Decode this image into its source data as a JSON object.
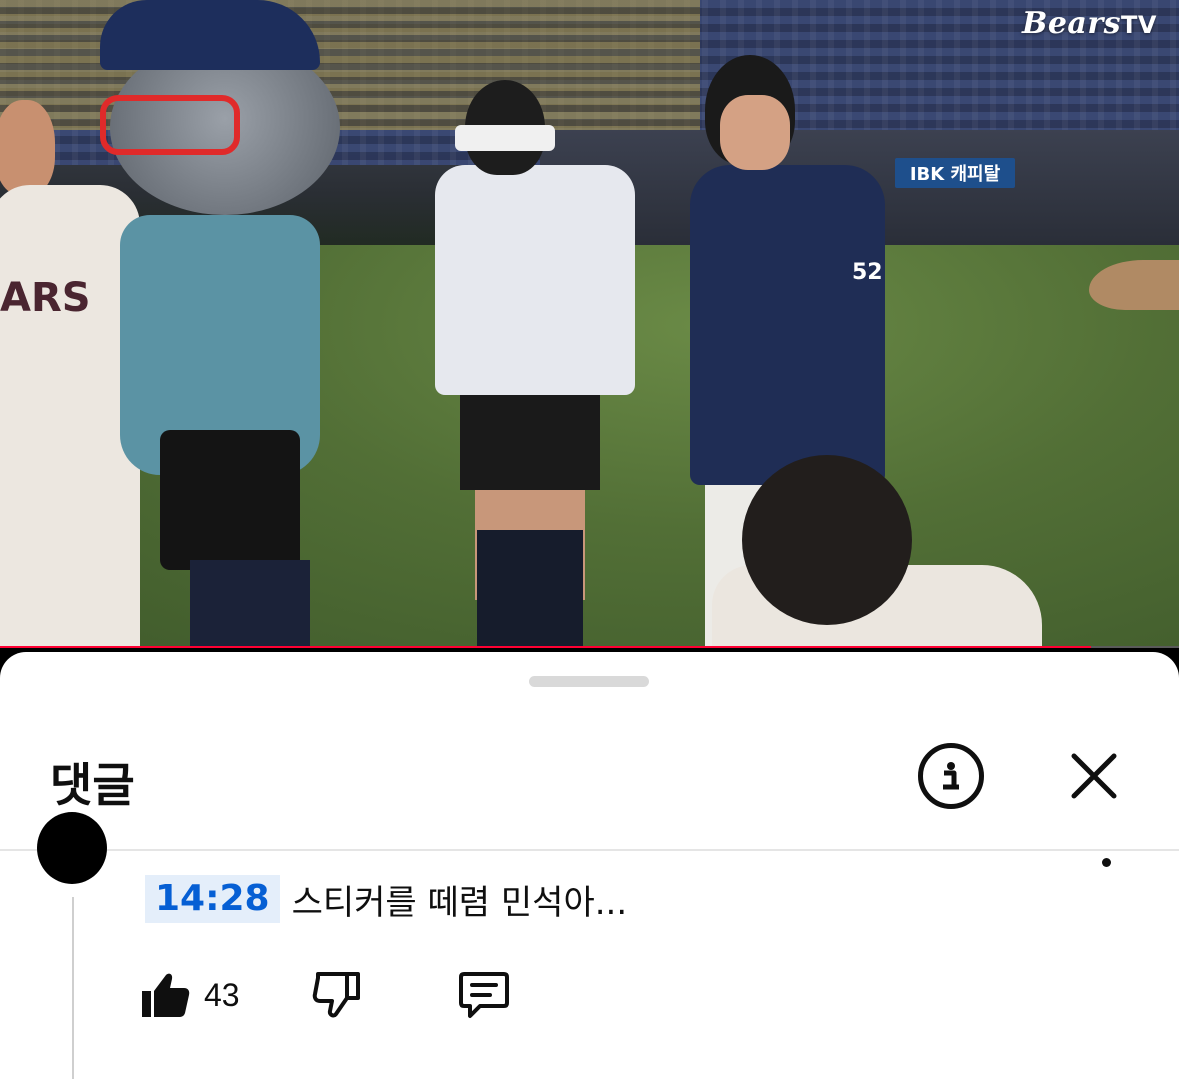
{
  "video": {
    "channel_logo": "Bears",
    "channel_logo_suffix": "TV",
    "sign_text": "IBK 캐피탈",
    "jersey_text": "ARS",
    "jersey_number": "52",
    "progress_fraction": 0.925,
    "progress_color": "#ff0033"
  },
  "comments_sheet": {
    "title": "댓글",
    "info_icon": "info-circle-icon",
    "close_icon": "close-x-icon",
    "comment": {
      "timestamp": "14:28",
      "text": "스티커를 떼렴 민석아...",
      "like_count": "43"
    }
  },
  "colors": {
    "timestamp_link": "#065fd4",
    "timestamp_bg": "#e4eefa",
    "text": "#0f0f0f"
  }
}
